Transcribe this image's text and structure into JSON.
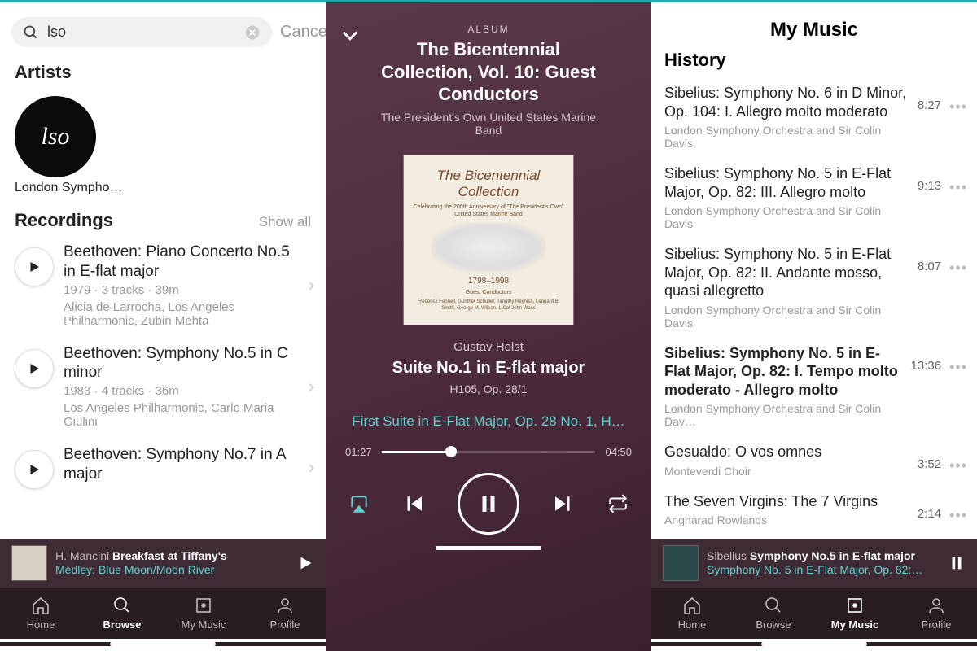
{
  "pane1": {
    "search_value": "lso",
    "cancel": "Cancel",
    "artists_header": "Artists",
    "artist_logo_text": "lso",
    "artist_name": "London Sympho…",
    "recordings_header": "Recordings",
    "show_all": "Show all",
    "recordings": [
      {
        "title": "Beethoven: Piano Concerto No.5 in E-flat major",
        "meta": "1979 · 3 tracks · 39m",
        "artists": "Alicia de Larrocha, Los Angeles Philharmonic, Zubin Mehta"
      },
      {
        "title": "Beethoven: Symphony No.5 in C minor",
        "meta": "1983 · 4 tracks · 36m",
        "artists": "Los Angeles Philharmonic, Carlo Maria Giulini"
      },
      {
        "title": "Beethoven: Symphony No.7 in A major",
        "meta": "",
        "artists": ""
      }
    ],
    "mini": {
      "artist": "H. Mancini",
      "album": "Breakfast at Tiffany's",
      "track": "Medley: Blue Moon/Moon River"
    },
    "tabs": {
      "home": "Home",
      "browse": "Browse",
      "mymusic": "My Music",
      "profile": "Profile",
      "active": "browse"
    }
  },
  "pane2": {
    "label": "ALBUM",
    "title": "The Bicentennial Collection, Vol. 10: Guest Conductors",
    "subtitle": "The President's Own United States Marine Band",
    "cover": {
      "t1": "The Bicentennial Collection",
      "t2": "Celebrating the 200th Anniversary of \"The President's Own\" United States Marine Band",
      "years": "1798–1998",
      "sub": "Guest Conductors",
      "names": "Frederick Fennell, Gunther Schuller, Timothy Reynish, Leonard B. Smith, George M. Wilson, LtCol John Wass"
    },
    "composer": "Gustav Holst",
    "work": "Suite No.1 in E-flat major",
    "catalog": "H105, Op. 28/1",
    "track": "First Suite in E-Flat Major, Op. 28 No. 1, H…",
    "elapsed": "01:27",
    "total": "04:50"
  },
  "pane3": {
    "title": "My Music",
    "section": "History",
    "items": [
      {
        "title": "Sibelius: Symphony No. 6 in D Minor, Op. 104: I. Allegro molto moderato",
        "artist": "London Symphony Orchestra and Sir Colin Davis",
        "dur": "8:27"
      },
      {
        "title": "Sibelius: Symphony No. 5 in E-Flat Major, Op. 82: III. Allegro molto",
        "artist": "London Symphony Orchestra and Sir Colin Davis",
        "dur": "9:13"
      },
      {
        "title": "Sibelius: Symphony No. 5 in E-Flat Major, Op. 82: II. Andante mosso, quasi allegretto",
        "artist": "London Symphony Orchestra and Sir Colin Davis",
        "dur": "8:07"
      },
      {
        "title": "Sibelius: Symphony No. 5 in E-Flat Major, Op. 82: I. Tempo molto moderato - Allegro molto",
        "artist": "London Symphony Orchestra and Sir Colin Dav…",
        "dur": "13:36",
        "current": true
      },
      {
        "title": "Gesualdo: O vos omnes",
        "artist": "Monteverdi Choir",
        "dur": "3:52"
      },
      {
        "title": "The Seven Virgins: The 7 Virgins",
        "artist": "Angharad Rowlands",
        "dur": "2:14"
      }
    ],
    "mini": {
      "artist": "Sibelius",
      "album": "Symphony No.5 in E-flat major",
      "track": "Symphony No. 5 in E-Flat Major, Op. 82:…"
    },
    "tabs": {
      "home": "Home",
      "browse": "Browse",
      "mymusic": "My Music",
      "profile": "Profile",
      "active": "mymusic"
    }
  }
}
